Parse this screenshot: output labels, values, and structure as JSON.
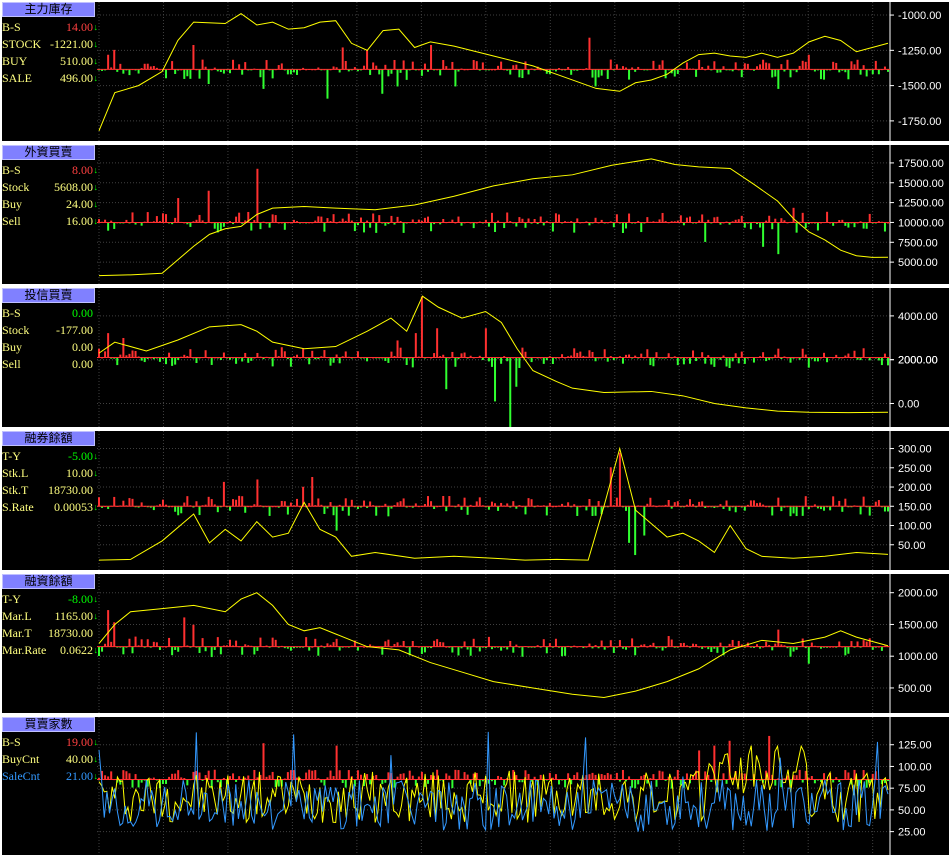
{
  "colors": {
    "background": "#000000",
    "border": "#ffffff",
    "title_bg": "#8080ff",
    "yellow": "#ffff00",
    "red": "#ff3030",
    "green": "#30ff30",
    "blue": "#3399ff",
    "grid": "#404040",
    "axis_text": "#ffffff",
    "label_yellow": "#ffff80",
    "value_red": "#ff4040",
    "value_green": "#00ff00"
  },
  "panels": [
    {
      "id": "p1",
      "title": "主力庫存",
      "legend": [
        {
          "label": "B-S",
          "value": "14.00",
          "arrow": "↓",
          "color": "label_yellow",
          "value_color": "value_red"
        },
        {
          "label": "STOCK",
          "value": "-1221.00",
          "arrow": "↓",
          "color": "label_yellow",
          "value_color": "label_yellow"
        },
        {
          "label": "BUY",
          "value": "510.00",
          "arrow": "↓",
          "color": "label_yellow",
          "value_color": "label_yellow"
        },
        {
          "label": "SALE",
          "value": "496.00",
          "arrow": "↓",
          "color": "label_yellow",
          "value_color": "label_yellow"
        }
      ],
      "y_ticks": [
        "-1000.00",
        "-1250.00",
        "-1500.00",
        "-1750.00"
      ]
    },
    {
      "id": "p2",
      "title": "外資買賣",
      "legend": [
        {
          "label": "B-S",
          "value": "8.00",
          "arrow": "↓",
          "color": "label_yellow",
          "value_color": "value_red"
        },
        {
          "label": "Stock",
          "value": "5608.00",
          "arrow": "↓",
          "color": "label_yellow",
          "value_color": "label_yellow"
        },
        {
          "label": "Buy",
          "value": "24.00",
          "arrow": "↓",
          "color": "label_yellow",
          "value_color": "label_yellow"
        },
        {
          "label": "Sell",
          "value": "16.00",
          "arrow": "↓",
          "color": "label_yellow",
          "value_color": "label_yellow"
        }
      ],
      "y_ticks": [
        "17500.00",
        "15000.00",
        "12500.00",
        "10000.00",
        "7500.00",
        "5000.00"
      ]
    },
    {
      "id": "p3",
      "title": "投信買賣",
      "legend": [
        {
          "label": "B-S",
          "value": "0.00",
          "arrow": "",
          "color": "label_yellow",
          "value_color": "value_green"
        },
        {
          "label": "Stock",
          "value": "-177.00",
          "arrow": "",
          "color": "label_yellow",
          "value_color": "label_yellow"
        },
        {
          "label": "Buy",
          "value": "0.00",
          "arrow": "",
          "color": "label_yellow",
          "value_color": "label_yellow"
        },
        {
          "label": "Sell",
          "value": "0.00",
          "arrow": "",
          "color": "label_yellow",
          "value_color": "label_yellow"
        }
      ],
      "y_ticks": [
        "4000.00",
        "2000.00",
        "2000.00",
        "0.00"
      ]
    },
    {
      "id": "p4",
      "title": "融券餘額",
      "legend": [
        {
          "label": "T-Y",
          "value": "-5.00",
          "arrow": "↓",
          "color": "label_yellow",
          "value_color": "value_green"
        },
        {
          "label": "Stk.L",
          "value": "10.00",
          "arrow": "↓",
          "color": "label_yellow",
          "value_color": "label_yellow"
        },
        {
          "label": "Stk.T",
          "value": "18730.00",
          "arrow": "",
          "color": "label_yellow",
          "value_color": "label_yellow"
        },
        {
          "label": "S.Rate",
          "value": "0.00053",
          "arrow": "↓",
          "color": "label_yellow",
          "value_color": "label_yellow"
        }
      ],
      "y_ticks": [
        "300.00",
        "250.00",
        "200.00",
        "150.00",
        "100.00",
        "50.00"
      ]
    },
    {
      "id": "p5",
      "title": "融資餘額",
      "legend": [
        {
          "label": "T-Y",
          "value": "-8.00",
          "arrow": "↓",
          "color": "label_yellow",
          "value_color": "value_green"
        },
        {
          "label": "Mar.L",
          "value": "1165.00",
          "arrow": "↓",
          "color": "label_yellow",
          "value_color": "label_yellow"
        },
        {
          "label": "Mar.T",
          "value": "18730.00",
          "arrow": "",
          "color": "label_yellow",
          "value_color": "label_yellow"
        },
        {
          "label": "Mar.Rate",
          "value": "0.0622",
          "arrow": "↓",
          "color": "label_yellow",
          "value_color": "label_yellow"
        }
      ],
      "y_ticks": [
        "2000.00",
        "1500.00",
        "1000.00",
        "500.00"
      ]
    },
    {
      "id": "p6",
      "title": "買賣家數",
      "legend": [
        {
          "label": "B-S",
          "value": "19.00",
          "arrow": "↓",
          "color": "label_yellow",
          "value_color": "value_red"
        },
        {
          "label": "BuyCnt",
          "value": "40.00",
          "arrow": "↓",
          "color": "label_yellow",
          "value_color": "label_yellow"
        },
        {
          "label": "SaleCnt",
          "value": "21.00",
          "arrow": "↓",
          "color": "blue",
          "value_color": "blue"
        }
      ],
      "y_ticks": [
        "125.00",
        "100.00",
        "75.00",
        "50.00",
        "25.00"
      ]
    }
  ],
  "chart_data": [
    {
      "type": "bar",
      "title": "主力庫存",
      "bars": "B-S",
      "line": "STOCK",
      "ylim": [
        -1850,
        -950
      ],
      "ticks": [
        -1000,
        -1250,
        -1500,
        -1750
      ],
      "baseline": -1385,
      "bar_seed": 3,
      "bar_scale": 1.0,
      "line_points": [
        [
          0,
          -1820
        ],
        [
          0.02,
          -1550
        ],
        [
          0.05,
          -1500
        ],
        [
          0.08,
          -1400
        ],
        [
          0.1,
          -1180
        ],
        [
          0.12,
          -1050
        ],
        [
          0.16,
          -1060
        ],
        [
          0.18,
          -990
        ],
        [
          0.2,
          -1070
        ],
        [
          0.22,
          -1050
        ],
        [
          0.24,
          -1100
        ],
        [
          0.26,
          -1090
        ],
        [
          0.28,
          -1050
        ],
        [
          0.3,
          -1040
        ],
        [
          0.32,
          -1200
        ],
        [
          0.34,
          -1250
        ],
        [
          0.36,
          -1110
        ],
        [
          0.38,
          -1100
        ],
        [
          0.4,
          -1230
        ],
        [
          0.42,
          -1190
        ],
        [
          0.45,
          -1220
        ],
        [
          0.5,
          -1290
        ],
        [
          0.55,
          -1360
        ],
        [
          0.58,
          -1420
        ],
        [
          0.6,
          -1460
        ],
        [
          0.63,
          -1520
        ],
        [
          0.66,
          -1540
        ],
        [
          0.68,
          -1480
        ],
        [
          0.7,
          -1460
        ],
        [
          0.72,
          -1420
        ],
        [
          0.74,
          -1340
        ],
        [
          0.76,
          -1280
        ],
        [
          0.78,
          -1270
        ],
        [
          0.8,
          -1290
        ],
        [
          0.82,
          -1300
        ],
        [
          0.84,
          -1270
        ],
        [
          0.86,
          -1300
        ],
        [
          0.88,
          -1270
        ],
        [
          0.9,
          -1190
        ],
        [
          0.92,
          -1150
        ],
        [
          0.94,
          -1180
        ],
        [
          0.96,
          -1260
        ],
        [
          0.98,
          -1230
        ],
        [
          1,
          -1200
        ]
      ],
      "spikes": [
        [
          0.01,
          0.6
        ],
        [
          0.02,
          0.8
        ],
        [
          0.12,
          1.0
        ],
        [
          0.14,
          -0.6
        ],
        [
          0.21,
          -0.8
        ],
        [
          0.29,
          -1.2
        ],
        [
          0.31,
          0.9
        ],
        [
          0.34,
          0.8
        ],
        [
          0.36,
          -1.0
        ],
        [
          0.38,
          -0.7
        ],
        [
          0.42,
          1.0
        ],
        [
          0.45,
          -0.7
        ],
        [
          0.62,
          1.3
        ],
        [
          0.63,
          -0.7
        ],
        [
          0.86,
          -0.8
        ],
        [
          0.9,
          0.6
        ]
      ]
    },
    {
      "type": "bar",
      "title": "外資買賣",
      "bars": "B-S",
      "line": "Stock",
      "ylim": [
        3000,
        19000
      ],
      "ticks": [
        17500,
        15000,
        12500,
        10000,
        7500,
        5000
      ],
      "baseline": 10000,
      "bar_seed": 7,
      "bar_scale": 1.0,
      "line_points": [
        [
          0,
          3300
        ],
        [
          0.04,
          3400
        ],
        [
          0.08,
          3600
        ],
        [
          0.1,
          5300
        ],
        [
          0.12,
          7000
        ],
        [
          0.14,
          8500
        ],
        [
          0.16,
          9200
        ],
        [
          0.18,
          9500
        ],
        [
          0.2,
          11000
        ],
        [
          0.22,
          11800
        ],
        [
          0.26,
          12000
        ],
        [
          0.3,
          11800
        ],
        [
          0.35,
          11600
        ],
        [
          0.4,
          12200
        ],
        [
          0.45,
          13300
        ],
        [
          0.5,
          14600
        ],
        [
          0.55,
          15500
        ],
        [
          0.6,
          16000
        ],
        [
          0.65,
          17200
        ],
        [
          0.7,
          18000
        ],
        [
          0.73,
          17300
        ],
        [
          0.76,
          17000
        ],
        [
          0.8,
          16800
        ],
        [
          0.83,
          14800
        ],
        [
          0.86,
          12700
        ],
        [
          0.88,
          10500
        ],
        [
          0.9,
          8800
        ],
        [
          0.92,
          7800
        ],
        [
          0.94,
          6500
        ],
        [
          0.96,
          5800
        ],
        [
          0.98,
          5600
        ],
        [
          1,
          5608
        ]
      ],
      "spikes": [
        [
          0.1,
          1.0
        ],
        [
          0.14,
          1.3
        ],
        [
          0.2,
          2.2
        ],
        [
          0.77,
          -0.8
        ],
        [
          0.84,
          -1.0
        ],
        [
          0.86,
          -1.3
        ],
        [
          0.88,
          0.6
        ]
      ]
    },
    {
      "type": "bar",
      "title": "投信買賣",
      "bars": "B-S",
      "line": "Stock",
      "ylim": [
        -800,
        5000
      ],
      "ticks": [
        4000,
        2000,
        2000,
        0
      ],
      "baseline": 2100,
      "bar_seed": 11,
      "bar_scale": 1.0,
      "line_points": [
        [
          0,
          2300
        ],
        [
          0.02,
          2800
        ],
        [
          0.06,
          2400
        ],
        [
          0.1,
          2900
        ],
        [
          0.14,
          3500
        ],
        [
          0.18,
          3600
        ],
        [
          0.2,
          3300
        ],
        [
          0.22,
          2800
        ],
        [
          0.26,
          2500
        ],
        [
          0.3,
          2600
        ],
        [
          0.34,
          3300
        ],
        [
          0.37,
          3900
        ],
        [
          0.39,
          3300
        ],
        [
          0.41,
          4900
        ],
        [
          0.43,
          4400
        ],
        [
          0.46,
          3900
        ],
        [
          0.49,
          4200
        ],
        [
          0.51,
          3700
        ],
        [
          0.53,
          2500
        ],
        [
          0.55,
          1500
        ],
        [
          0.58,
          1000
        ],
        [
          0.6,
          700
        ],
        [
          0.64,
          500
        ],
        [
          0.7,
          550
        ],
        [
          0.74,
          350
        ],
        [
          0.78,
          0
        ],
        [
          0.82,
          -200
        ],
        [
          0.86,
          -350
        ],
        [
          0.9,
          -400
        ],
        [
          0.95,
          -420
        ],
        [
          1,
          -400
        ]
      ],
      "spikes": [
        [
          0.01,
          1.0
        ],
        [
          0.03,
          0.8
        ],
        [
          0.38,
          0.7
        ],
        [
          0.4,
          1.0
        ],
        [
          0.41,
          2.5
        ],
        [
          0.43,
          1.2
        ],
        [
          0.44,
          -1.3
        ],
        [
          0.49,
          1.2
        ],
        [
          0.5,
          -1.8
        ],
        [
          0.52,
          -3.0
        ],
        [
          0.53,
          -1.2
        ]
      ]
    },
    {
      "type": "bar",
      "title": "融券餘額",
      "bars": "T-Y",
      "line": "Stk.L",
      "ylim": [
        0,
        330
      ],
      "ticks": [
        300,
        250,
        200,
        150,
        100,
        50
      ],
      "baseline": 150,
      "bar_seed": 17,
      "bar_scale": 1.0,
      "line_points": [
        [
          0,
          10
        ],
        [
          0.04,
          12
        ],
        [
          0.08,
          60
        ],
        [
          0.12,
          130
        ],
        [
          0.14,
          55
        ],
        [
          0.16,
          90
        ],
        [
          0.18,
          60
        ],
        [
          0.2,
          110
        ],
        [
          0.22,
          70
        ],
        [
          0.24,
          80
        ],
        [
          0.26,
          160
        ],
        [
          0.28,
          90
        ],
        [
          0.3,
          70
        ],
        [
          0.32,
          20
        ],
        [
          0.35,
          30
        ],
        [
          0.4,
          15
        ],
        [
          0.45,
          20
        ],
        [
          0.5,
          15
        ],
        [
          0.54,
          10
        ],
        [
          0.58,
          12
        ],
        [
          0.62,
          10
        ],
        [
          0.64,
          150
        ],
        [
          0.66,
          300
        ],
        [
          0.68,
          140
        ],
        [
          0.7,
          105
        ],
        [
          0.72,
          70
        ],
        [
          0.74,
          80
        ],
        [
          0.76,
          60
        ],
        [
          0.78,
          30
        ],
        [
          0.8,
          100
        ],
        [
          0.82,
          40
        ],
        [
          0.84,
          20
        ],
        [
          0.88,
          15
        ],
        [
          0.92,
          20
        ],
        [
          0.96,
          30
        ],
        [
          1,
          25
        ]
      ],
      "spikes": [
        [
          0.16,
          1.0
        ],
        [
          0.2,
          1.1
        ],
        [
          0.26,
          0.8
        ],
        [
          0.27,
          1.2
        ],
        [
          0.3,
          -1.0
        ],
        [
          0.65,
          1.6
        ],
        [
          0.66,
          2.2
        ],
        [
          0.67,
          -1.5
        ],
        [
          0.68,
          -2.0
        ],
        [
          0.69,
          -1.2
        ]
      ]
    },
    {
      "type": "bar",
      "title": "融資餘額",
      "bars": "T-Y",
      "line": "Mar.L",
      "ylim": [
        200,
        2200
      ],
      "ticks": [
        2000,
        1500,
        1000,
        500
      ],
      "baseline": 1150,
      "bar_seed": 23,
      "bar_scale": 1.0,
      "line_points": [
        [
          0,
          1200
        ],
        [
          0.02,
          1500
        ],
        [
          0.04,
          1700
        ],
        [
          0.08,
          1750
        ],
        [
          0.12,
          1800
        ],
        [
          0.16,
          1700
        ],
        [
          0.18,
          1900
        ],
        [
          0.2,
          2000
        ],
        [
          0.22,
          1800
        ],
        [
          0.24,
          1500
        ],
        [
          0.26,
          1400
        ],
        [
          0.28,
          1450
        ],
        [
          0.3,
          1350
        ],
        [
          0.34,
          1150
        ],
        [
          0.38,
          1100
        ],
        [
          0.42,
          900
        ],
        [
          0.46,
          750
        ],
        [
          0.5,
          600
        ],
        [
          0.55,
          500
        ],
        [
          0.6,
          400
        ],
        [
          0.64,
          350
        ],
        [
          0.68,
          450
        ],
        [
          0.72,
          600
        ],
        [
          0.76,
          800
        ],
        [
          0.8,
          1100
        ],
        [
          0.84,
          1250
        ],
        [
          0.88,
          1200
        ],
        [
          0.92,
          1300
        ],
        [
          0.94,
          1400
        ],
        [
          0.96,
          1300
        ],
        [
          1,
          1165
        ]
      ],
      "spikes": [
        [
          0.01,
          1.5
        ],
        [
          0.02,
          1.0
        ],
        [
          0.11,
          1.2
        ],
        [
          0.12,
          0.9
        ],
        [
          0.86,
          0.7
        ],
        [
          0.9,
          -0.7
        ]
      ]
    },
    {
      "type": "bar",
      "title": "買賣家數",
      "bars": "B-S",
      "lines": [
        "BuyCnt",
        "SaleCnt"
      ],
      "ylim": [
        5,
        150
      ],
      "ticks": [
        125,
        100,
        75,
        50,
        25
      ],
      "baseline": 85,
      "bar_seed": 31,
      "bar_scale": 1.0,
      "noisy": true,
      "spikes": [
        [
          0.21,
          1.5
        ],
        [
          0.3,
          1.4
        ],
        [
          0.76,
          1.2
        ],
        [
          0.78,
          1.4
        ],
        [
          0.8,
          1.6
        ],
        [
          0.85,
          1.8
        ]
      ]
    }
  ]
}
